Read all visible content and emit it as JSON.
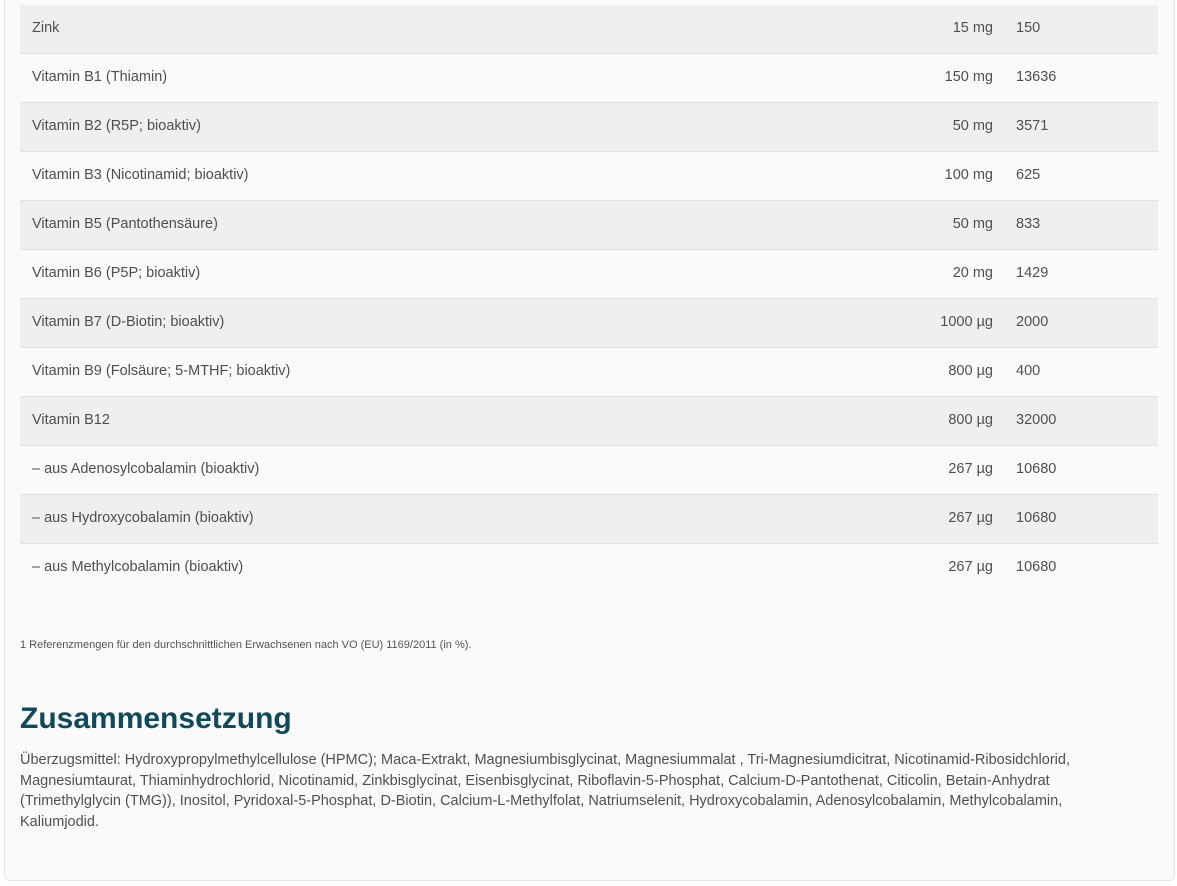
{
  "nutrients": [
    {
      "name": "Zink",
      "amount": "15 mg",
      "ref": "150"
    },
    {
      "name": "Vitamin B1 (Thiamin)",
      "amount": "150 mg",
      "ref": "13636"
    },
    {
      "name": "Vitamin B2 (R5P; bioaktiv)",
      "amount": "50 mg",
      "ref": "3571"
    },
    {
      "name": "Vitamin B3 (Nicotinamid; bioaktiv)",
      "amount": "100 mg",
      "ref": "625"
    },
    {
      "name": "Vitamin B5 (Pantothensäure)",
      "amount": "50 mg",
      "ref": "833"
    },
    {
      "name": "Vitamin B6 (P5P; bioaktiv)",
      "amount": "20 mg",
      "ref": " 1429"
    },
    {
      "name": "Vitamin B7 (D-Biotin; bioaktiv)",
      "amount": "1000 µg",
      "ref": "2000"
    },
    {
      "name": "Vitamin B9 (Folsäure; 5-MTHF; bioaktiv)",
      "amount": "800 µg",
      "ref": "400"
    },
    {
      "name": "Vitamin B12",
      "amount": "800 µg",
      "ref": "32000"
    },
    {
      "name": "– aus Adenosylcobalamin (bioaktiv)",
      "amount": "267 µg",
      "ref": "10680"
    },
    {
      "name": "– aus Hydroxycobalamin (bioaktiv)",
      "amount": "267 µg",
      "ref": "10680"
    },
    {
      "name": "– aus Methylcobalamin (bioaktiv)",
      "amount": "267 µg",
      "ref": "10680"
    }
  ],
  "footnote": "1 Referenzmengen für den durchschnittlichen Erwachsenen nach VO (EU) 1169/2011 (in %).",
  "composition": {
    "heading": "Zusammensetzung",
    "text": "Überzugsmittel: Hydroxypropylmethylcellulose (HPMC); Maca-Extrakt, Magnesiumbisglycinat, Magnesiummalat , Tri-Magnesiumdicitrat, Nicotinamid-Ribosidchlorid, Magnesiumtaurat, Thiaminhydrochlorid, Nicotinamid, Zinkbisglycinat, Eisenbisglycinat, Riboflavin-5-Phosphat, Calcium-D-Pantothenat, Citicolin, Betain-Anhydrat (Trimethylglycin (TMG)), Inositol, Pyridoxal-5-Phosphat, D-Biotin, Calcium-L-Methylfolat, Natriumselenit, Hydroxycobalamin, Adenosylcobalamin, Methylcobalamin, Kaliumjodid."
  },
  "colors": {
    "heading": "#0e4a5c",
    "row_shade": "#efefef",
    "text": "#4f4f4f"
  }
}
